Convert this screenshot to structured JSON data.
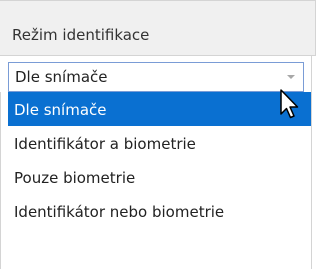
{
  "header": {
    "label": "Režim identifikace"
  },
  "combo": {
    "value": "Dle snímače"
  },
  "dropdown": {
    "options": [
      {
        "label": "Dle snímače",
        "selected": true
      },
      {
        "label": "Identifikátor a biometrie",
        "selected": false
      },
      {
        "label": "Pouze biometrie",
        "selected": false
      },
      {
        "label": "Identifikátor nebo biometrie",
        "selected": false
      }
    ]
  },
  "colors": {
    "selection": "#0a70d1",
    "header_bg": "#f0f0f0",
    "border": "#d4d4d4",
    "combo_border": "#7a9cd6"
  },
  "icons": [
    "chevron-down-icon",
    "mouse-cursor-icon"
  ]
}
